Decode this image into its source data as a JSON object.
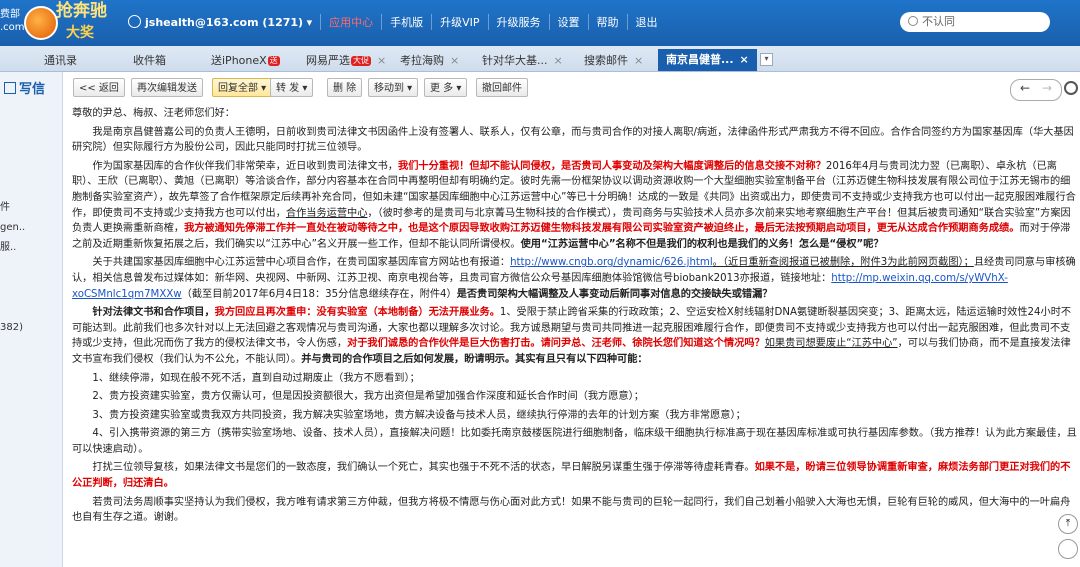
{
  "header": {
    "brand_left": "费部 .com",
    "logo_text": "抢奔驰",
    "logo_sub": "大奖",
    "account": "jshealth@163.com (1271)",
    "nav": [
      "应用中心",
      "手机版",
      "升级VIP",
      "升级服务",
      "设置",
      "帮助",
      "退出"
    ],
    "search_placeholder": "不认同"
  },
  "tabs": [
    {
      "label": "通讯录"
    },
    {
      "label": "收件箱"
    },
    {
      "label": "送iPhoneX"
    },
    {
      "label": "网易严选"
    },
    {
      "label": "考拉海购"
    },
    {
      "label": "针对华大基..."
    },
    {
      "label": "搜索邮件"
    },
    {
      "label": "南京昌健普..."
    }
  ],
  "tab_badges": {
    "iphone": "送",
    "yanxuan": "大促"
  },
  "sidebar": {
    "compose": "写信",
    "items": [
      "件",
      "gen..",
      "服..",
      "382)"
    ]
  },
  "toolbar": {
    "back": "<< 返回",
    "edit_resend": "再次编辑发送",
    "reply_all": "回复全部",
    "forward": "转 发",
    "delete": "删 除",
    "move_to": "移动到",
    "more": "更 多",
    "recall": "撤回邮件"
  },
  "email": {
    "greeting": "尊敬的尹总、梅叔、汪老师您们好：",
    "p1": "我是南京昌健普嘉公司的负责人王德明，日前收到贵司法律文书因函件上没有签署人、联系人，仅有公章，而与贵司合作的对接人离职/病逝，法律函件形式严肃我方不得不回应。合作合同签约方为国家基因库（华大基因研究院）但实际履行方为股份公司，因此只能同时打扰三位领导。",
    "p2_a": "作为国家基因库的合作伙伴我们非常荣幸，近日收到贵司法律文书，",
    "p2_red1": "我们十分重视！但却不能认同侵权，是否贵司人事变动及架构大幅度调整后的信息交接不对称？",
    "p2_b": "2016年4月与贵司沈力翌（已离职）、卓永杭（已离职）、王欣（已离职）、黄旭（已离职）等洽谈合作，部分内容基本在合同中再整明但却有明确约定。彼时先需一份框架协议以调动资源收购一个大型细胞实验室制备平台（江苏迈健生物科技发展有限公司位于江苏无锡市的细胞制备实验室资产），故先草签了合作框架原定后续再补充合同，但如未建“国家基因库细胞中心江苏运营中心”等已十分明确！达成的一致是《共同》出资或出力，即使贵司不支持或少支持我方也可以付出一起克服困难履行合作，即使贵司不支持或少支持我方也可以付出，",
    "p2_u": "合作当务运营中心",
    "p2_c": "，（彼时参考的是贵司与北京菁马生物科技的合作模式），贵司商务与实验技术人员亦多次前来实地考察细胞生产平台！但其后被贵司通知“联合实验室”方案因负责人更换需重新商榷，",
    "p2_red2": "我方被通知先停滞工作并一直处在被动等待之中，也是这个原因导致收购江苏迈健生物科技发展有限公司实验室资产被迫终止，最后无法按预期启动项目，更无从达成合作预期商务成绩。",
    "p2_d": "而对于停滞之前及近期重新恢复拓展之后，我们确实以“江苏中心”名义开展一些工作，但却不能认同所谓侵权。",
    "p2_bold": "使用“江苏运营中心”名称不但是我们的权利也是我们的义务！怎么是“侵权”呢？",
    "p3_a": "关于共建国家基因库细胞中心江苏运营中心项目合作，在贵司国家基因库官方网站也有报道：",
    "p3_link1": "http://www.cngb.org/dynamic/626.jhtml",
    "p3_u1": "。（近日重新查阅报道已被删除，附件3为此前网页截图）；",
    "p3_b": "且经贵司同意与审核确认，相关信息曾发布过媒体如：新华网、央视网、中新网、江苏卫视、南京电视台等，且贵司官方微信公众号基因库细胞体验馆微信号biobank2013亦报道，链接地址：",
    "p3_link2": "http://mp.weixin.qq.com/s/yWVhX-xoCSMnlc1qm7MXXw",
    "p3_c": "（截至目前2017年6月4日18：35分信息继续存在，附件4）",
    "p3_bold": "是否贵司架构大幅调整及人事变动后新同事对信息的交接缺失或错漏？",
    "p4_bold1": "针对法律文书和合作项目，",
    "p4_red1": "我方回应且再次重申：没有实验室（本地制备）无法开展业务。",
    "p4_a": "1、受限于禁止跨省采集的行政政策；2、空运安检X射线辐射DNA氨键断裂基因突变；3、距离太远，陆运运输时效性24小时不可能达到。此前我们也多次针对以上无法回避之客观情况与贵司沟通，大家也都以理解多次讨论。我方诚恳期望与贵司共同推进一起克服困难履行合作，即便贵司不支持或少支持我方也可以付出一起克服困难，但此贵司不支持或少支持，但此况而伤了我方的侵权法律文书，令人伤感，",
    "p4_red2": "对于我们诚恳的合作伙伴是巨大伤害打击。请问尹总、汪老师、徐院长您们知道这个情况吗？",
    "p4_u": "如果贵司想要废止“江苏中心”",
    "p4_b": "，可以与我们协商，而不是直接发法律文书宣布我们侵权（我们认为不公允，不能认同）。",
    "p4_bold2": "并与贵司的合作项目之后如何发展，盼请明示。其实有且只有以下四种可能：",
    "li1": "1、继续停滞，如现在般不死不活，直到自动过期废止（我方不愿看到）；",
    "li2": "2、贵方投资建实验室，贵方仅需认可，但是因投资额很大，我方出资但是希望加强合作深度和延长合作时间（我方愿意）；",
    "li3": "3、贵方投资建实验室或贵我双方共同投资，我方解决实验室场地，贵方解决设备与技术人员，继续执行停滞的去年的计划方案（我方非常愿意）；",
    "li4": "4、引入携带资源的第三方（携带实验室场地、设备、技术人员），直接解决问题！比如委托南京鼓楼医院进行细胞制备，临床级干细胞执行标准高于现在基因库标准或可执行基因库参数。（我方推荐！认为此方案最佳，且可以快速启动）。",
    "p5_a": "打扰三位领导复核，如果法律文书是您们的一致态度，我们确认一个死亡，其实也强于不死不活的状态，早日解脱另谋重生强于停滞等待虚耗青春。",
    "p5_red": "如果不是，盼请三位领导协调重新审查，麻烦法务部门更正对我们的不公正判断，归还清白。",
    "p6": "若贵司法务周顺事实坚持认为我们侵权，我方唯有请求第三方仲裁，但我方将极不情愿与伤心面对此方式！如果不能与贵司的巨轮一起同行，我们自己划着小船驶入大海也无惧，巨轮有巨轮的威风，但大海中的一叶扁舟也自有生存之道。谢谢。"
  },
  "colors": {
    "header_blue": "#1a5fad",
    "alert_red": "#e00000",
    "link_blue": "#1a55c8"
  }
}
